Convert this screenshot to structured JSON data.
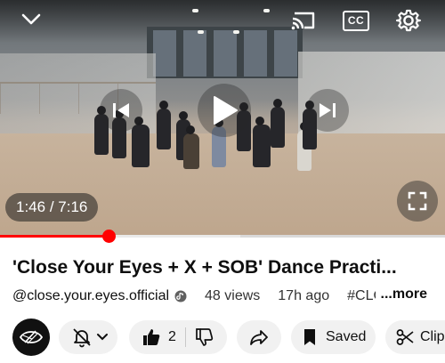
{
  "player": {
    "current_time": "1:46",
    "duration": "7:16",
    "time_separator": " / ",
    "progress_fraction": 0.243,
    "buffer_fraction": 0.54,
    "icons": {
      "collapse": "chevron-down-icon",
      "cast": "cast-icon",
      "captions": "closed-captions-icon",
      "settings": "gear-icon",
      "previous": "skip-previous-icon",
      "play": "play-icon",
      "next": "skip-next-icon",
      "fullscreen": "fullscreen-icon"
    },
    "captions_label": "CC"
  },
  "video": {
    "title": "'Close Your Eyes + X + SOB' Dance Practi...",
    "channel": "@close.your.eyes.official",
    "views": "48 views",
    "age": "17h ago",
    "hashtag": "#CLOSE",
    "more_label": "...more"
  },
  "actions": {
    "like_count": "2",
    "saved_label": "Saved",
    "clip_label": "Clip"
  },
  "colors": {
    "accent": "#ff0000",
    "text": "#0f0f0f",
    "chip_bg": "#f1f1f1"
  }
}
